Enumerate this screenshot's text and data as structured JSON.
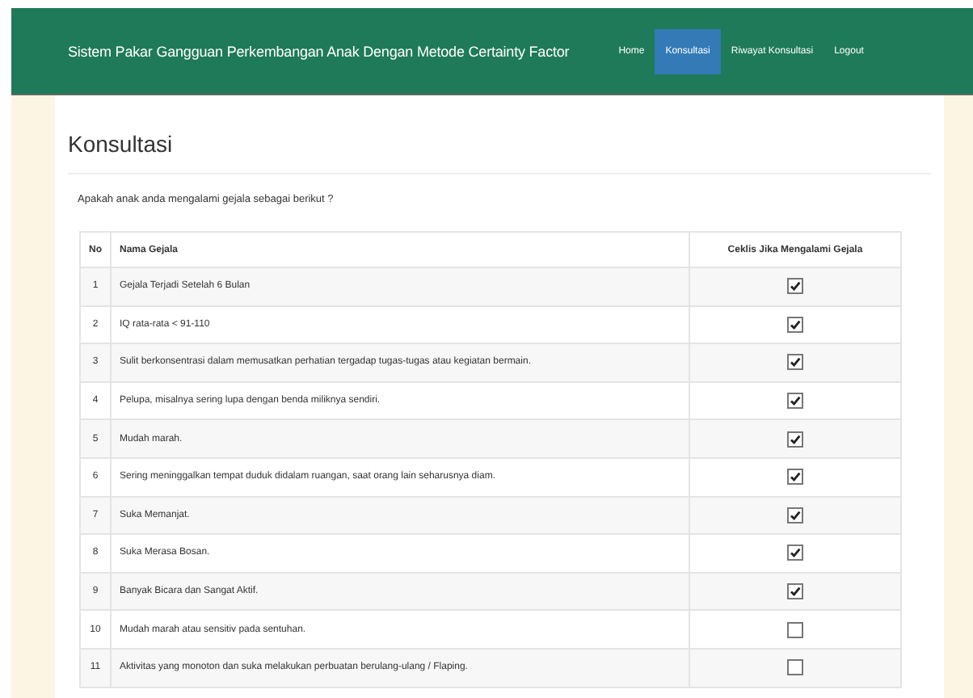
{
  "navbar": {
    "brand": "Sistem Pakar Gangguan Perkembangan Anak Dengan Metode Certainty Factor",
    "links": [
      {
        "label": "Home",
        "selected": false
      },
      {
        "label": "Konsultasi",
        "selected": true
      },
      {
        "label": "Riwayat Konsultasi",
        "selected": false
      },
      {
        "label": "Logout",
        "selected": false
      }
    ]
  },
  "page": {
    "title": "Konsultasi",
    "question": "Apakah anak anda mengalami gejala sebagai berikut ?"
  },
  "table": {
    "columns": [
      "No",
      "Nama Gejala",
      "Ceklis Jika Mengalami Gejala"
    ],
    "rows": [
      {
        "no": "1",
        "name": "Gejala Terjadi Setelah 6 Bulan",
        "checked": true
      },
      {
        "no": "2",
        "name": "IQ rata-rata < 91-110",
        "checked": true
      },
      {
        "no": "3",
        "name": "Sulit berkonsentrasi dalam memusatkan perhatian tergadap tugas-tugas atau kegiatan bermain.",
        "checked": true
      },
      {
        "no": "4",
        "name": "Pelupa, misalnya sering lupa dengan benda miliknya sendiri.",
        "checked": true
      },
      {
        "no": "5",
        "name": "Mudah marah.",
        "checked": true
      },
      {
        "no": "6",
        "name": "Sering meninggalkan tempat duduk didalam ruangan, saat orang lain seharusnya diam.",
        "checked": true
      },
      {
        "no": "7",
        "name": "Suka Memanjat.",
        "checked": true
      },
      {
        "no": "8",
        "name": "Suka Merasa Bosan.",
        "checked": true
      },
      {
        "no": "9",
        "name": "Banyak Bicara dan Sangat Aktif.",
        "checked": true
      },
      {
        "no": "10",
        "name": "Mudah marah atau sensitiv pada sentuhan.",
        "checked": false
      },
      {
        "no": "11",
        "name": "Aktivitas yang monoton dan suka melakukan perbuatan berulang-ulang / Flaping.",
        "checked": false
      }
    ]
  }
}
